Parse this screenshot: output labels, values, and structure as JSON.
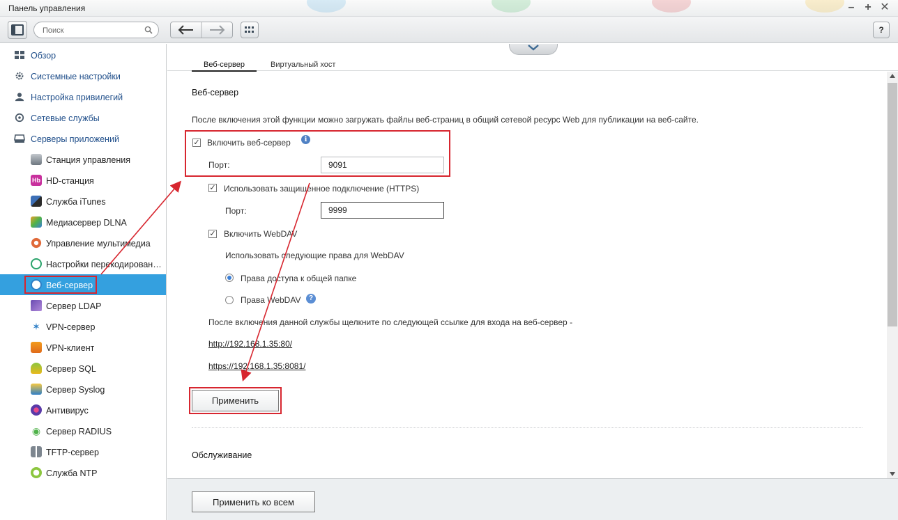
{
  "window": {
    "title": "Панель управления"
  },
  "toolbar": {
    "search_placeholder": "Поиск",
    "help_label": "?"
  },
  "sidebar": {
    "top_items": [
      {
        "label": "Обзор"
      },
      {
        "label": "Системные настройки"
      },
      {
        "label": "Настройка привилегий"
      },
      {
        "label": "Сетевые службы"
      },
      {
        "label": "Серверы приложений"
      }
    ],
    "sub_items": [
      {
        "label": "Станция управления"
      },
      {
        "label": "HD-станция"
      },
      {
        "label": "Служба iTunes"
      },
      {
        "label": "Медиасервер DLNA"
      },
      {
        "label": "Управление мультимедиа"
      },
      {
        "label": "Настройки перекодирования"
      },
      {
        "label": "Веб-сервер"
      },
      {
        "label": "Сервер LDAP"
      },
      {
        "label": "VPN-сервер"
      },
      {
        "label": "VPN-клиент"
      },
      {
        "label": "Сервер SQL"
      },
      {
        "label": "Сервер Syslog"
      },
      {
        "label": "Антивирус"
      },
      {
        "label": "Сервер RADIUS"
      },
      {
        "label": "TFTP-сервер"
      },
      {
        "label": "Служба NTP"
      }
    ],
    "active_index": 6
  },
  "tabs": [
    {
      "label": "Веб-сервер"
    },
    {
      "label": "Виртуальный хост"
    }
  ],
  "webserver": {
    "title": "Веб-сервер",
    "description": "После включения этой функции можно загружать файлы веб-страниц в общий сетевой ресурс Web для публикации на веб-сайте.",
    "enable_label": "Включить веб-сервер",
    "port_label": "Порт:",
    "port_value": "9091",
    "https_label": "Использовать защищенное подключение (HTTPS)",
    "https_port_label": "Порт:",
    "https_port_value": "9999",
    "webdav_label": "Включить WebDAV",
    "webdav_rights_label": "Использовать следующие права для WebDAV",
    "radio_share": "Права доступа к общей папке",
    "radio_webdav": "Права WebDAV",
    "after_enable_text": "После включения данной службы щелкните по следующей ссылке для входа на веб-сервер -",
    "link_http": "http://192.168.1.35:80/",
    "link_https": "https://192.168.1.35:8081/",
    "apply_label": "Применить"
  },
  "maintenance": {
    "title": "Обслуживание"
  },
  "footer": {
    "apply_all_label": "Применить ко всем"
  },
  "colors": {
    "accent": "#34a0df",
    "highlight": "#d7262f"
  }
}
